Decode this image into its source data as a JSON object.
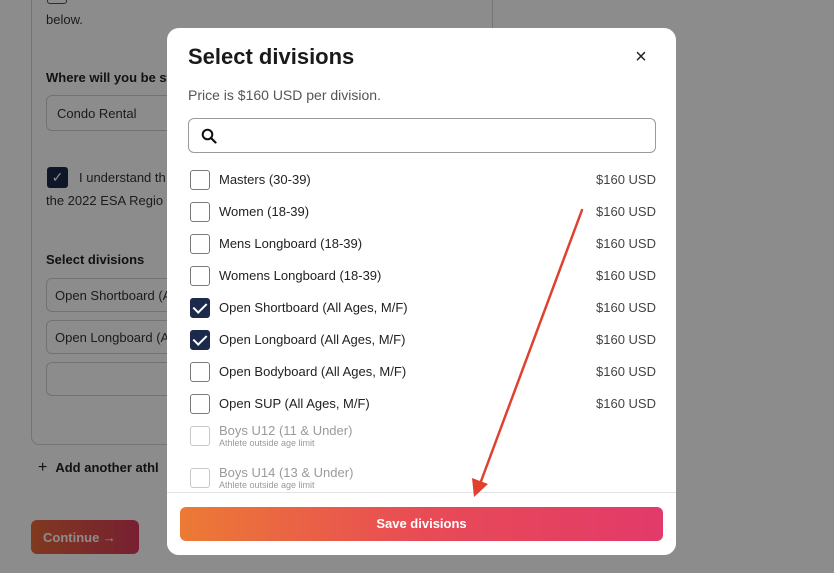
{
  "background": {
    "below_text": "below.",
    "where_label": "Where will you be st",
    "where_value": "Condo Rental",
    "understand_text": "I understand th",
    "esa_text": "the 2022 ESA Regio",
    "select_divisions_label": "Select divisions",
    "selected_divisions": [
      "Open Shortboard (A",
      "Open Longboard (A",
      ""
    ],
    "add_athlete": "Add another athl",
    "continue_label": "Continue →"
  },
  "modal": {
    "title": "Select divisions",
    "close_icon": "×",
    "price_note": "Price is $160 USD per division.",
    "search_placeholder": "",
    "divisions": [
      {
        "label": "Masters (30-39)",
        "price": "$160 USD",
        "checked": false,
        "disabled": false
      },
      {
        "label": "Women (18-39)",
        "price": "$160 USD",
        "checked": false,
        "disabled": false
      },
      {
        "label": "Mens Longboard (18-39)",
        "price": "$160 USD",
        "checked": false,
        "disabled": false
      },
      {
        "label": "Womens Longboard (18-39)",
        "price": "$160 USD",
        "checked": false,
        "disabled": false
      },
      {
        "label": "Open Shortboard (All Ages, M/F)",
        "price": "$160 USD",
        "checked": true,
        "disabled": false
      },
      {
        "label": "Open Longboard (All Ages, M/F)",
        "price": "$160 USD",
        "checked": true,
        "disabled": false
      },
      {
        "label": "Open Bodyboard (All Ages, M/F)",
        "price": "$160 USD",
        "checked": false,
        "disabled": false
      },
      {
        "label": "Open SUP (All Ages, M/F)",
        "price": "$160 USD",
        "checked": false,
        "disabled": false
      },
      {
        "label": "Boys U12 (11 & Under)",
        "sub": "Athlete outside age limit",
        "price": "",
        "checked": false,
        "disabled": true
      },
      {
        "label": "Boys U14 (13 & Under)",
        "sub": "Athlete outside age limit",
        "price": "",
        "checked": false,
        "disabled": true
      }
    ],
    "save_label": "Save divisions"
  },
  "colors": {
    "checkbox_checked": "#1b2a4a",
    "button_gradient_start": "#ec7a35",
    "button_gradient_end": "#e23a6a",
    "annotation_arrow": "#e0412f"
  }
}
